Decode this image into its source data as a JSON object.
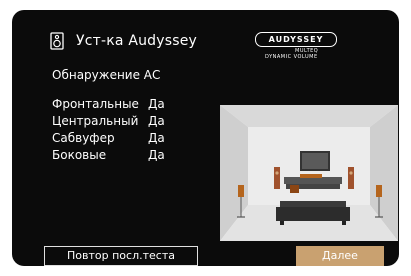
{
  "header": {
    "icon": "speaker-icon",
    "title": "Уст-ка Audyssey",
    "subtitle": "Обнаружение АС"
  },
  "logo": {
    "brand": "AUDYSSEY",
    "line1": "MULTEQ",
    "line2": "DYNAMIC VOLUME"
  },
  "detection": {
    "rows": [
      {
        "label": "Фронтальные",
        "value": "Да"
      },
      {
        "label": "Центральный",
        "value": "Да"
      },
      {
        "label": "Сабвуфер",
        "value": "Да"
      },
      {
        "label": "Боковые",
        "value": "Да"
      }
    ]
  },
  "buttons": {
    "retest_label": "Повтор посл.теста",
    "next_label": "Далее"
  },
  "colors": {
    "accent": "#c9a170",
    "background": "#0b0b0b"
  }
}
